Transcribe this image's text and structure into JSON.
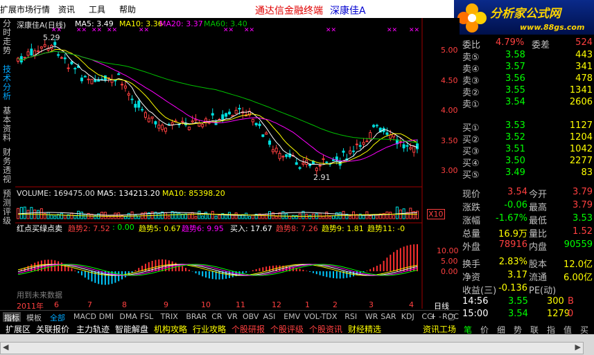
{
  "menu": {
    "items": [
      "扩展市场行情",
      "资讯",
      "工具",
      "帮助"
    ],
    "title_red": "通达信金融终端",
    "title_blue": "深康佳A"
  },
  "logo": {
    "text": "分析家公式网",
    "url": "www.88gs.com"
  },
  "sidebar": {
    "tabs": [
      "分时走势",
      "技术分析",
      "基本资料",
      "财务透视",
      "预测评级"
    ]
  },
  "chart": {
    "header": {
      "name": "深康佳A(日线)",
      "ma5": "MA5: 3.49",
      "ma10": "MA10: 3.36",
      "ma20": "MA20: 3.37",
      "ma60": "MA60: 3.40"
    },
    "price_ticks": [
      "5.00",
      "4.50",
      "4.00",
      "3.50",
      "3.00"
    ],
    "high_label": "5.29",
    "low_label": "2.91",
    "volume": {
      "label": "VOLUME: 169475.00",
      "ma5": "MA5: 134213.20",
      "ma10": "MA10: 85398.20",
      "tick": "X10"
    },
    "indicator": {
      "label": "红点买绿点卖",
      "t2": "趋势2: 7.52",
      "t2b": ": 0.00",
      "t5": "趋势5: 0.67",
      "t6": "趋势6: 9.95",
      "buy": "买入: 17.67",
      "t8": "趋势8: 7.26",
      "t9": "趋势9: 1.81",
      "t11": "趋势11: -0",
      "ticks": [
        "10.00",
        "5.00",
        "0.00"
      ]
    },
    "future_text": "用到未来数据",
    "time_axis": [
      "2011年",
      "6",
      "7",
      "8",
      "9",
      "10",
      "11",
      "12",
      "1",
      "2",
      "3",
      "4"
    ],
    "period": "日线"
  },
  "indicator_tabs": [
    "指标",
    "模板",
    "全部",
    "MACD",
    "DMI",
    "DMA",
    "FSL",
    "TRIX",
    "BRAR",
    "CR",
    "VR",
    "OBV",
    "ASI",
    "EMV",
    "VOL-TDX",
    "RSI",
    "WR",
    "SAR",
    "KDJ",
    "CCI",
    "ROC"
  ],
  "bottom_tabs": [
    "扩展区",
    "关联报价",
    "主力轨迹",
    "智能解盘",
    "机构攻略",
    "行业攻略",
    "个股研报",
    "个股评级",
    "个股资讯",
    "财经精选",
    "资讯工场"
  ],
  "quote": {
    "weibi": "委比",
    "weibi_v": "4.79%",
    "weicha": "委差",
    "weicha_v": "524",
    "asks": [
      {
        "l": "卖⑤",
        "p": "3.58",
        "v": "443"
      },
      {
        "l": "卖④",
        "p": "3.57",
        "v": "341"
      },
      {
        "l": "卖③",
        "p": "3.56",
        "v": "478"
      },
      {
        "l": "卖②",
        "p": "3.55",
        "v": "1341"
      },
      {
        "l": "卖①",
        "p": "3.54",
        "v": "2606"
      }
    ],
    "bids": [
      {
        "l": "买①",
        "p": "3.53",
        "v": "1127"
      },
      {
        "l": "买②",
        "p": "3.52",
        "v": "1204"
      },
      {
        "l": "买③",
        "p": "3.51",
        "v": "1042"
      },
      {
        "l": "买④",
        "p": "3.50",
        "v": "2277"
      },
      {
        "l": "买⑤",
        "p": "3.49",
        "v": "83"
      }
    ],
    "stats": [
      {
        "a": "现价",
        "av": "3.54",
        "b": "今开",
        "bv": "3.79",
        "ac": "#ff4040",
        "bc": "#ff4040"
      },
      {
        "a": "涨跌",
        "av": "-0.06",
        "b": "最高",
        "bv": "3.79",
        "ac": "#00ff00",
        "bc": "#ff4040"
      },
      {
        "a": "涨幅",
        "av": "-1.67%",
        "b": "最低",
        "bv": "3.53",
        "ac": "#00ff00",
        "bc": "#00ff00"
      },
      {
        "a": "总量",
        "av": "16.9万",
        "b": "量比",
        "bv": "1.52",
        "ac": "#ffff00",
        "bc": "#ff4040"
      },
      {
        "a": "外盘",
        "av": "78916",
        "b": "内盘",
        "bv": "90559",
        "ac": "#ff4040",
        "bc": "#00ff00"
      },
      {
        "a": "换手",
        "av": "2.83%",
        "b": "股本",
        "bv": "12.0亿",
        "ac": "#ffff00",
        "bc": "#ffff00"
      },
      {
        "a": "净资",
        "av": "3.17",
        "b": "流通",
        "bv": "6.00亿",
        "ac": "#ffff00",
        "bc": "#ffff00"
      },
      {
        "a": "收益(三)",
        "av": "-0.136",
        "b": "PE(动)",
        "bv": "",
        "ac": "#ffff00",
        "bc": "#ffff00"
      }
    ],
    "ticks": [
      {
        "t": "14:56",
        "p": "3.55",
        "v": "300",
        "f": "B"
      },
      {
        "t": "15:00",
        "p": "3.54",
        "v": "1279",
        "f": "0"
      }
    ]
  },
  "right_tabs": [
    "笔",
    "价",
    "细",
    "势",
    "联",
    "指",
    "值",
    "买"
  ]
}
